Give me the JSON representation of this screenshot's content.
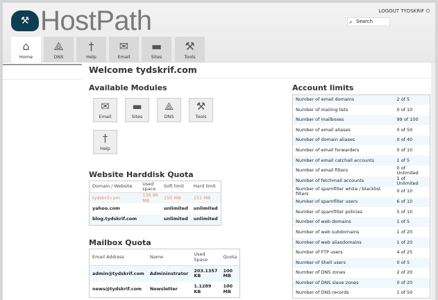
{
  "header": {
    "brand": "HostPath",
    "logout": "LOGOUT TYDSKRIF",
    "search_placeholder": "Search"
  },
  "tabs": [
    {
      "label": "Home",
      "icon": "home-icon"
    },
    {
      "label": "DNS",
      "icon": "dns-icon"
    },
    {
      "label": "Help",
      "icon": "help-icon"
    },
    {
      "label": "Email",
      "icon": "email-icon"
    },
    {
      "label": "Sites",
      "icon": "folder-icon"
    },
    {
      "label": "Tools",
      "icon": "tools-icon"
    }
  ],
  "welcome": "Welcome tydskrif.com",
  "modules": {
    "title": "Available Modules",
    "items": [
      {
        "label": "Email"
      },
      {
        "label": "Sites"
      },
      {
        "label": "DNS"
      },
      {
        "label": "Tools"
      },
      {
        "label": "Help"
      }
    ]
  },
  "harddisk": {
    "title": "Website Harddisk Quota",
    "headers": [
      "Domain / Website",
      "Used space",
      "Soft limit",
      "Hard limit"
    ],
    "rows": [
      [
        "tydskrif.com",
        "136.96 MB",
        "150 MB",
        "151 MB"
      ],
      [
        "yahoo.com",
        "",
        "unlimited",
        "unlimited"
      ],
      [
        "blog.tydskrif.com",
        "",
        "unlimited",
        "unlimited"
      ]
    ],
    "warn_color": "#f08a4b"
  },
  "mailbox": {
    "title": "Mailbox Quota",
    "headers": [
      "Email Address",
      "Name",
      "Used Space",
      "Quota"
    ],
    "rows": [
      [
        "admin@tydskrif.com",
        "Admininstrator",
        "203.1357 KB",
        "100 MB"
      ],
      [
        "news@tydskrif.com",
        "Newsletter",
        "1.1289 KB",
        "100 MB"
      ]
    ]
  },
  "limits": {
    "title": "Account limits",
    "rows": [
      [
        "Number of email domains",
        "2 of 5"
      ],
      [
        "Number of mailing lists",
        "0 of 10"
      ],
      [
        "Number of mailboxes",
        "99 of 100"
      ],
      [
        "Number of email aliases",
        "0 of 50"
      ],
      [
        "Number of domain aliases",
        "0 of 40"
      ],
      [
        "Number of email forwarders",
        "0 of 10"
      ],
      [
        "Number of email catchall accounts",
        "1 of 5"
      ],
      [
        "Number of email filters",
        "0 of Unlimited"
      ],
      [
        "Number of fetchmail accounts",
        "1 of Unlimited"
      ],
      [
        "Number of spamfilter white / blacklist filters",
        "0 of 10"
      ],
      [
        "Number of spamfilter users",
        "6 of 10"
      ],
      [
        "Number of spamfilter policies",
        "5 of 10"
      ],
      [
        "Number of web domains",
        "1 of 5"
      ],
      [
        "Number of web subdomains",
        "1 of 20"
      ],
      [
        "Number of web aliasdomains",
        "1 of 20"
      ],
      [
        "Number of FTP users",
        "4 of 25"
      ],
      [
        "Number of Shell users",
        "0 of 5"
      ],
      [
        "Number of DNS zones",
        "2 of 20"
      ],
      [
        "Number of DNS slave zones",
        "0 of 20"
      ],
      [
        "Number of DNS records",
        "1 of 50"
      ]
    ]
  }
}
